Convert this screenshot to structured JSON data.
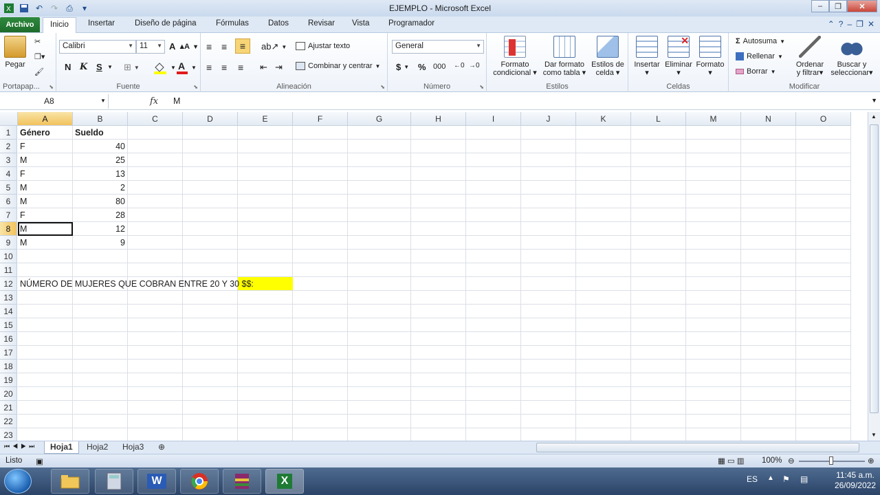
{
  "window": {
    "title": "EJEMPLO  -  Microsoft Excel"
  },
  "tabs": {
    "file": "Archivo",
    "items": [
      "Inicio",
      "Insertar",
      "Diseño de página",
      "Fórmulas",
      "Datos",
      "Revisar",
      "Vista",
      "Programador"
    ],
    "active": "Inicio"
  },
  "ribbon": {
    "clipboard": {
      "paste": "Pegar",
      "label": "Portapap..."
    },
    "font": {
      "name": "Calibri",
      "size": "11",
      "bold": "N",
      "italic": "K",
      "underline": "S",
      "label": "Fuente"
    },
    "alignment": {
      "wrap": "Ajustar texto",
      "merge": "Combinar y centrar",
      "label": "Alineación"
    },
    "number": {
      "format": "General",
      "currency": "$",
      "percent": "%",
      "thousands": "000",
      "label": "Número"
    },
    "styles": {
      "conditional": [
        "Formato",
        "condicional"
      ],
      "table": [
        "Dar formato",
        "como tabla"
      ],
      "cell": [
        "Estilos de",
        "celda"
      ],
      "label": "Estilos"
    },
    "cells": {
      "insert": "Insertar",
      "delete": "Eliminar",
      "format": "Formato",
      "label": "Celdas"
    },
    "editing": {
      "autosum": "Autosuma",
      "fill": "Rellenar",
      "clear": "Borrar",
      "sort": [
        "Ordenar",
        "y filtrar"
      ],
      "find": [
        "Buscar y",
        "seleccionar"
      ],
      "label": "Modificar"
    }
  },
  "formula_bar": {
    "namebox": "A8",
    "fx": "fx",
    "content": "M"
  },
  "columns": [
    "A",
    "B",
    "C",
    "D",
    "E",
    "F",
    "G",
    "H",
    "I",
    "J",
    "K",
    "L",
    "M",
    "N",
    "O"
  ],
  "selected_col": "A",
  "selected_row": 8,
  "rows": [
    "1",
    "2",
    "3",
    "4",
    "5",
    "6",
    "7",
    "8",
    "9",
    "10",
    "11",
    "12",
    "13",
    "14",
    "15",
    "16",
    "17",
    "18",
    "19",
    "20",
    "21",
    "22",
    "23"
  ],
  "cells": {
    "A1": "Género",
    "B1": "Sueldo",
    "A2": "F",
    "B2": "40",
    "A3": "M",
    "B3": "25",
    "A4": "F",
    "B4": "13",
    "A5": "M",
    "B5": "2",
    "A6": "M",
    "B6": "80",
    "A7": "F",
    "B7": "28",
    "A8": "M",
    "B8": "12",
    "A9": "M",
    "B9": "9",
    "A12": "NÚMERO DE MUJERES QUE COBRAN ENTRE 20 Y 30 $$:"
  },
  "highlight_color": "#ffff00",
  "sheets": [
    "Hoja1",
    "Hoja2",
    "Hoja3"
  ],
  "active_sheet": "Hoja1",
  "status": {
    "mode": "Listo",
    "zoom": "100%"
  },
  "taskbar": {
    "lang": "ES",
    "time": "11:45 a.m.",
    "date": "26/09/2022",
    "word": "W",
    "excel": "X"
  }
}
